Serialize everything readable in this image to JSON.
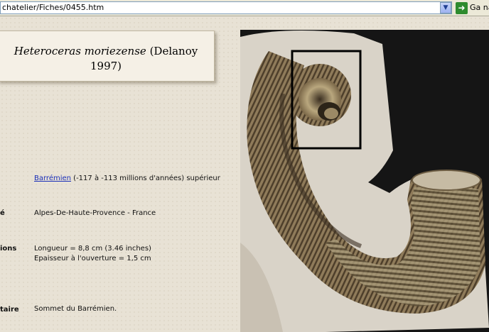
{
  "browser": {
    "address": "chatelier/Fiches/0455.htm",
    "go_label": "Ga na"
  },
  "fiche": {
    "title_species": "Heteroceras moriezense",
    "title_author": " (Delanoy",
    "title_year": "1997)",
    "age": {
      "label": "",
      "link": "Barrémien",
      "text": " (-117 à -113 millions d'années) supérieur"
    },
    "locality": {
      "label": "é",
      "value": "Alpes-De-Haute-Provence - France"
    },
    "dimensions": {
      "label": "ions",
      "length": "Longueur = 8,8 cm (3.46 inches)",
      "thickness": "Epaisseur à l'ouverture = 1,5 cm"
    },
    "comment": {
      "label": "taire",
      "value": "Sommet du Barrémien."
    }
  },
  "colors": {
    "page_bg": "#e8e2d5",
    "link": "#1a2fb8",
    "photo_bg": "#141414"
  }
}
